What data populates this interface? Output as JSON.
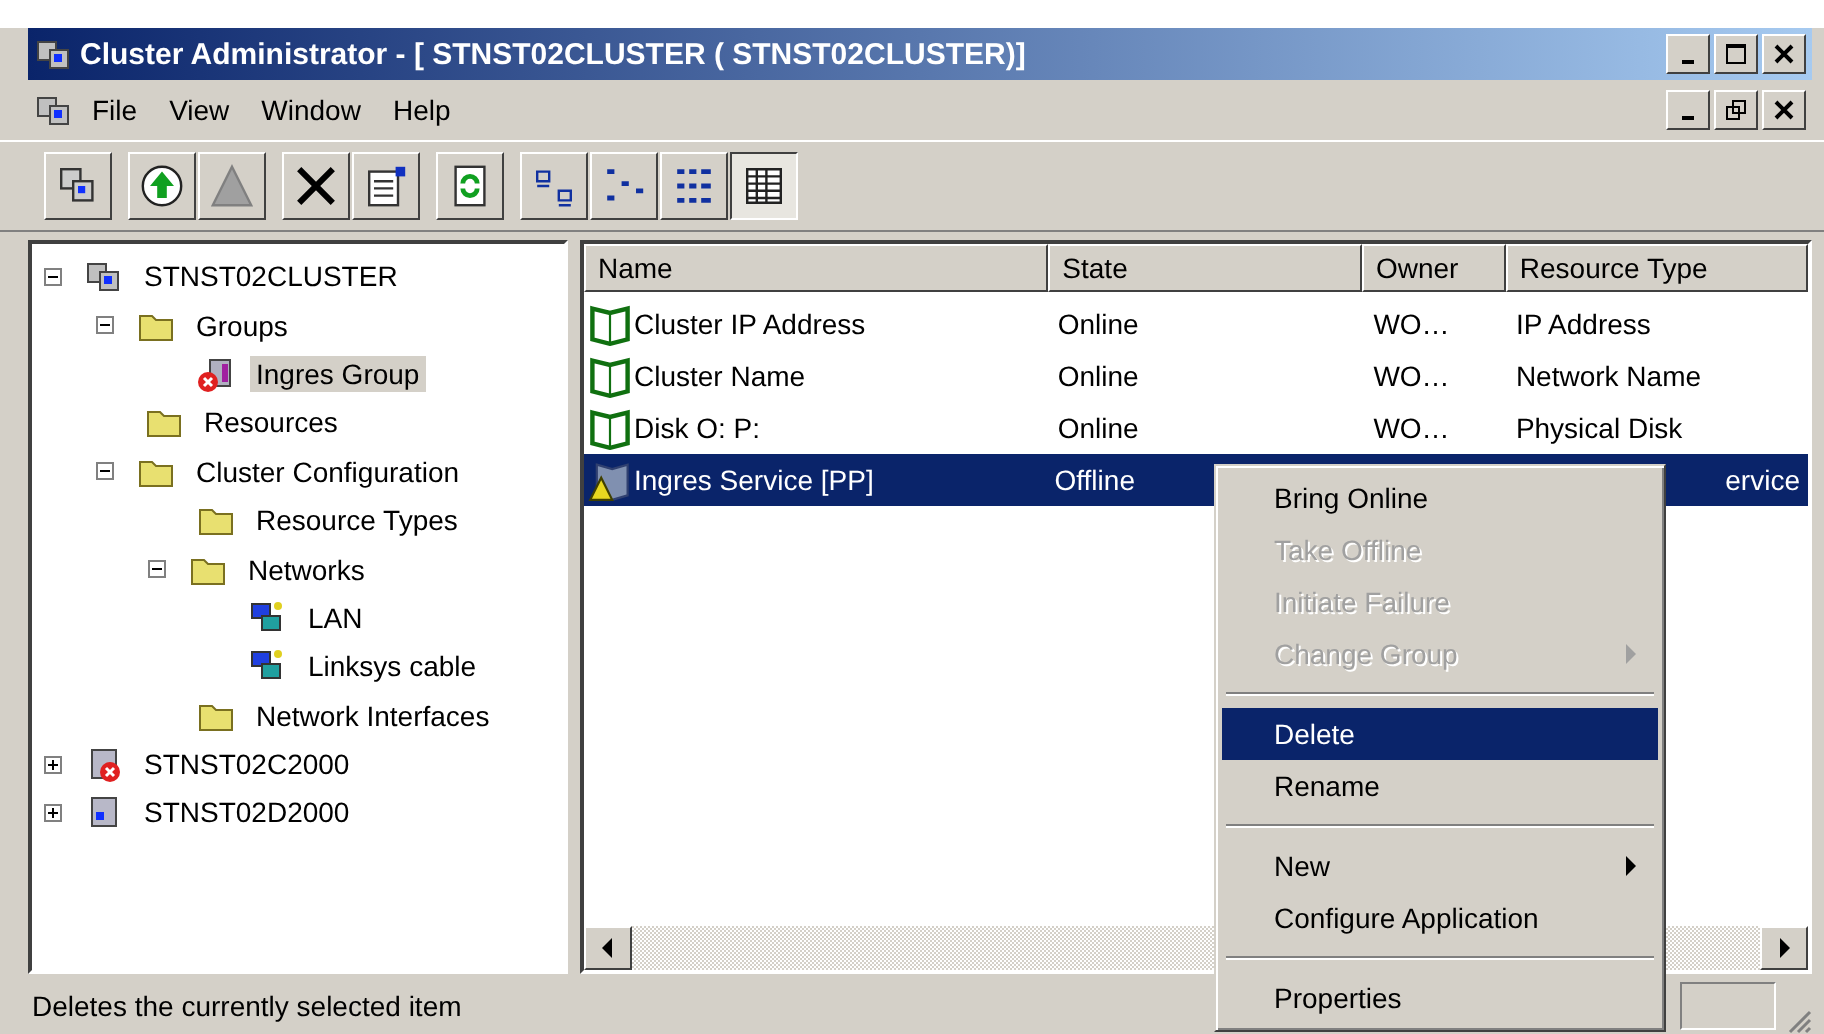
{
  "window": {
    "title": "Cluster Administrator - [ STNST02CLUSTER ( STNST02CLUSTER)]"
  },
  "menu": [
    "File",
    "View",
    "Window",
    "Help"
  ],
  "toolbar": [
    {
      "kind": "cluster",
      "pressed": false
    },
    {
      "kind": "separator"
    },
    {
      "kind": "online",
      "pressed": false
    },
    {
      "kind": "offline",
      "pressed": false
    },
    {
      "kind": "separator"
    },
    {
      "kind": "delete",
      "pressed": false
    },
    {
      "kind": "properties",
      "pressed": false
    },
    {
      "kind": "separator"
    },
    {
      "kind": "refresh",
      "pressed": false
    },
    {
      "kind": "separator"
    },
    {
      "kind": "large",
      "pressed": false
    },
    {
      "kind": "small",
      "pressed": false
    },
    {
      "kind": "list",
      "pressed": false
    },
    {
      "kind": "details",
      "pressed": true
    }
  ],
  "tree": [
    {
      "label": "STNST02CLUSTER",
      "kind": "cluster",
      "expanded": true,
      "selected": false,
      "children": [
        {
          "label": "Groups",
          "kind": "folder",
          "expanded": true,
          "selected": false,
          "children": [
            {
              "label": "Ingres Group",
              "kind": "group-error",
              "selected": true
            }
          ]
        },
        {
          "label": "Resources",
          "kind": "folder",
          "selected": false
        },
        {
          "label": "Cluster Configuration",
          "kind": "folder",
          "expanded": true,
          "selected": false,
          "children": [
            {
              "label": "Resource Types",
              "kind": "folder",
              "selected": false
            },
            {
              "label": "Networks",
              "kind": "folder",
              "expanded": true,
              "selected": false,
              "children": [
                {
                  "label": "LAN",
                  "kind": "network",
                  "selected": false
                },
                {
                  "label": "Linksys cable",
                  "kind": "network",
                  "selected": false
                }
              ]
            },
            {
              "label": "Network Interfaces",
              "kind": "folder",
              "selected": false
            }
          ]
        }
      ]
    },
    {
      "label": "STNST02C2000",
      "kind": "server-error",
      "expanded": false,
      "selected": false
    },
    {
      "label": "STNST02D2000",
      "kind": "server",
      "expanded": false,
      "selected": false
    }
  ],
  "table": {
    "columns": [
      "Name",
      "State",
      "Owner",
      "Resource Type"
    ],
    "rows": [
      {
        "name": "Cluster IP Address",
        "state": "Online",
        "owner": "WO…",
        "type": "IP Address",
        "kind": "online",
        "selected": false
      },
      {
        "name": "Cluster Name",
        "state": "Online",
        "owner": "WO…",
        "type": "Network Name",
        "kind": "online",
        "selected": false
      },
      {
        "name": "Disk O: P:",
        "state": "Online",
        "owner": "WO…",
        "type": "Physical Disk",
        "kind": "online",
        "selected": false
      },
      {
        "name": "Ingres Service [PP]",
        "state": "Offline",
        "type": "ervice",
        "kind": "warning",
        "selected": true
      }
    ]
  },
  "context_menu": [
    {
      "kind": "item",
      "label": "Bring Online",
      "disabled": false,
      "selected": false,
      "submenu": false
    },
    {
      "kind": "item",
      "label": "Take Offline",
      "disabled": true,
      "selected": false,
      "submenu": false
    },
    {
      "kind": "item",
      "label": "Initiate Failure",
      "disabled": true,
      "selected": false,
      "submenu": false
    },
    {
      "kind": "item",
      "label": "Change Group",
      "disabled": true,
      "selected": false,
      "submenu": true
    },
    {
      "kind": "separator"
    },
    {
      "kind": "item",
      "label": "Delete",
      "disabled": false,
      "selected": true,
      "submenu": false
    },
    {
      "kind": "item",
      "label": "Rename",
      "disabled": false,
      "selected": false,
      "submenu": false
    },
    {
      "kind": "separator"
    },
    {
      "kind": "item",
      "label": "New",
      "disabled": false,
      "selected": false,
      "submenu": true
    },
    {
      "kind": "item",
      "label": "Configure Application",
      "disabled": false,
      "selected": false,
      "submenu": false
    },
    {
      "kind": "separator"
    },
    {
      "kind": "item",
      "label": "Properties",
      "disabled": false,
      "selected": false,
      "submenu": false
    }
  ],
  "status_bar": {
    "text": "Deletes the currently selected item"
  }
}
